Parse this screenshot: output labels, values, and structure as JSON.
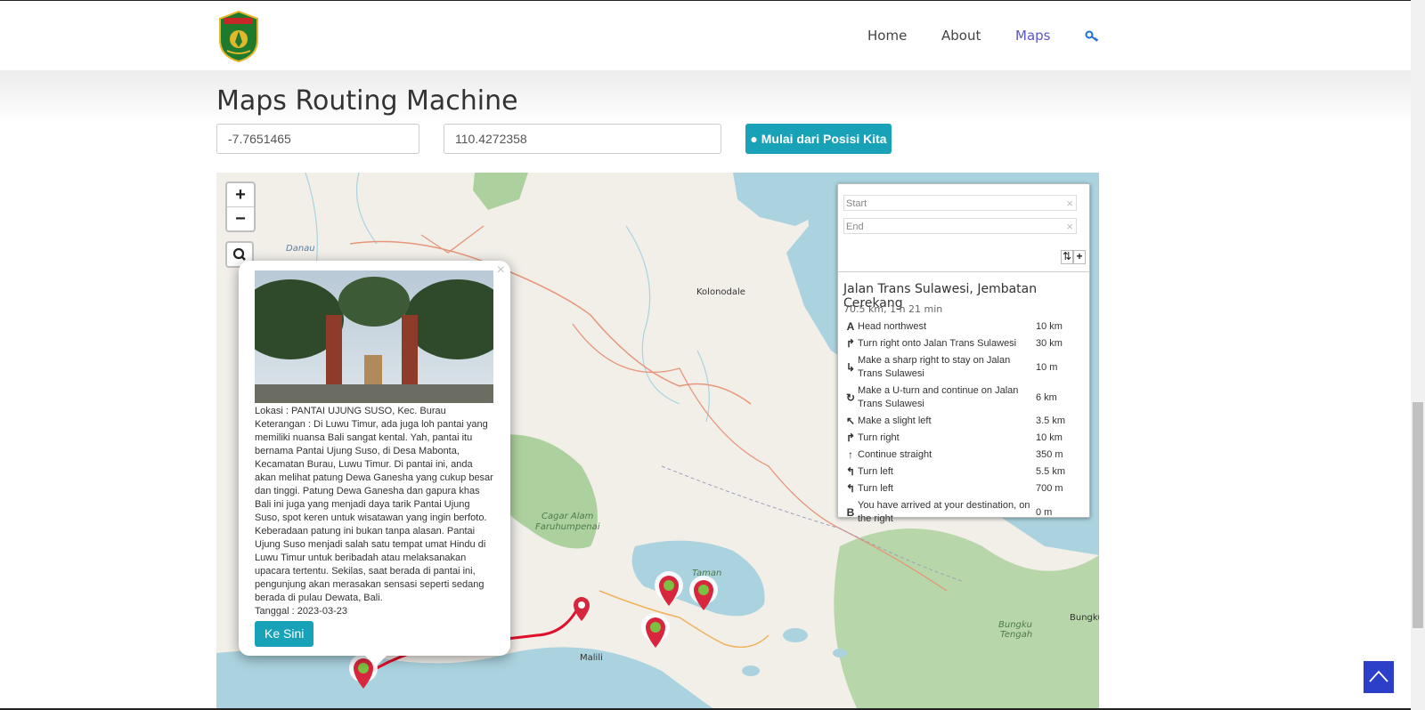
{
  "nav": {
    "home": "Home",
    "about": "About",
    "maps": "Maps",
    "logo_icon": "luwu-timur-emblem",
    "key_icon": "key-icon"
  },
  "page": {
    "title": "Maps Routing Machine"
  },
  "form": {
    "lat_value": "-7.7651465",
    "lng_value": "110.4272358",
    "locate_button": "Mulai dari Posisi Kita",
    "locate_icon": "map-marker-icon"
  },
  "map": {
    "zoom_in": "+",
    "zoom_out": "−",
    "search_icon": "search-icon",
    "labels": {
      "danau": "Danau",
      "kolonodale": "Kolonodale",
      "cagar1": "Cagar Alam",
      "cagar2": "Faruhumpenai",
      "taman": "Taman",
      "malili": "Malili",
      "bungku_tengah1": "Bungku",
      "bungku_tengah2": "Tengah",
      "bungku": "Bungku"
    }
  },
  "popup": {
    "close": "×",
    "image_alt": "Pantai Ujung Suso gate",
    "lokasi": "Lokasi : PANTAI UJUNG SUSO, Kec. Burau",
    "keterangan": "Keterangan : Di Luwu Timur, ada juga loh pantai yang memiliki nuansa Bali sangat kental. Yah, pantai itu bernama Pantai Ujung Suso, di Desa Mabonta, Kecamatan Burau, Luwu Timur. Di pantai ini, anda akan melihat patung Dewa Ganesha yang cukup besar dan tinggi. Patung Dewa Ganesha dan gapura khas Bali ini juga yang menjadi daya tarik Pantai Ujung Suso, spot keren untuk wisatawan yang ingin berfoto. Keberadaan patung ini bukan tanpa alasan. Pantai Ujung Suso menjadi salah satu tempat umat Hindu di Luwu Timur untuk beribadah atau melaksanakan upacara tertentu. Sekilas, saat berada di pantai ini, pengunjung akan merasakan sensasi seperti sedang berada di pulau Dewata, Bali.",
    "tanggal": "Tanggal : 2023-03-23",
    "button": "Ke Sini"
  },
  "routing": {
    "start_placeholder": "Start",
    "end_placeholder": "End",
    "clear": "×",
    "reverse": "⇅",
    "add": "+",
    "route_name": "Jalan Trans Sulawesi, Jembatan Cerekang",
    "summary": "70.5 km, 1 h 21 min",
    "instructions": [
      {
        "icon": "A",
        "icon_name": "depart-icon",
        "text": "Head northwest",
        "dist": "10 km"
      },
      {
        "icon": "↱",
        "icon_name": "turn-right-icon",
        "text": "Turn right onto Jalan Trans Sulawesi",
        "dist": "30 km"
      },
      {
        "icon": "↳",
        "icon_name": "sharp-right-icon",
        "text": "Make a sharp right to stay on Jalan Trans Sulawesi",
        "dist": "10 m"
      },
      {
        "icon": "↻",
        "icon_name": "u-turn-icon",
        "text": "Make a U-turn and continue on Jalan Trans Sulawesi",
        "dist": "6 km"
      },
      {
        "icon": "↖",
        "icon_name": "slight-left-icon",
        "text": "Make a slight left",
        "dist": "3.5 km"
      },
      {
        "icon": "↱",
        "icon_name": "turn-right-icon",
        "text": "Turn right",
        "dist": "10 km"
      },
      {
        "icon": "↑",
        "icon_name": "straight-icon",
        "text": "Continue straight",
        "dist": "350 m"
      },
      {
        "icon": "↰",
        "icon_name": "turn-left-icon",
        "text": "Turn left",
        "dist": "5.5 km"
      },
      {
        "icon": "↰",
        "icon_name": "turn-left-icon",
        "text": "Turn left",
        "dist": "700 m"
      },
      {
        "icon": "B",
        "icon_name": "arrive-icon",
        "text": "You have arrived at your destination, on the right",
        "dist": "0 m"
      }
    ]
  },
  "colors": {
    "accent": "#17a2b8",
    "nav_active": "#5a55c8",
    "back_to_top": "#2b3fc9",
    "water": "#aad3df",
    "forest": "#add19e",
    "route": "#e0102a"
  },
  "back_to_top_icon": "chevron-up-icon"
}
